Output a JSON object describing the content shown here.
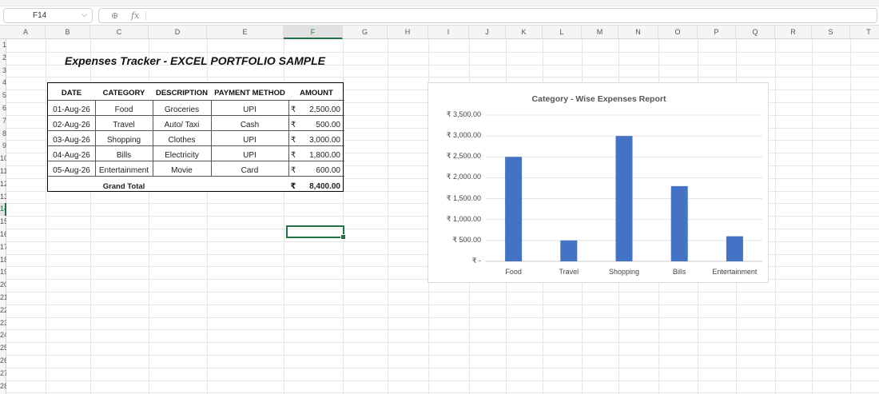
{
  "formula_bar": {
    "cell_reference": "F14",
    "chevron": "⌵",
    "zoom_icon": "⊕",
    "fx_label": "fx",
    "formula": ""
  },
  "columns": [
    "A",
    "B",
    "C",
    "D",
    "E",
    "F",
    "G",
    "H",
    "I",
    "J",
    "K",
    "L",
    "M",
    "N",
    "O",
    "P",
    "Q",
    "R",
    "S",
    "T"
  ],
  "rows": [
    "1",
    "2",
    "3",
    "4",
    "5",
    "6",
    "7",
    "8",
    "9",
    "10",
    "11",
    "12",
    "13",
    "14",
    "15",
    "16",
    "17",
    "18",
    "19",
    "20",
    "21",
    "22",
    "23",
    "24",
    "25",
    "26",
    "27",
    "28"
  ],
  "selected": {
    "column": "F",
    "row": "14"
  },
  "sheet": {
    "title": "Expenses Tracker - EXCEL PORTFOLIO SAMPLE",
    "table": {
      "headers": [
        "DATE",
        "CATEGORY",
        "DESCRIPTION",
        "PAYMENT METHOD",
        "AMOUNT"
      ],
      "rows": [
        {
          "date": "01-Aug-26",
          "category": "Food",
          "description": "Groceries",
          "payment": "UPI",
          "currency": "₹",
          "amount": "2,500.00"
        },
        {
          "date": "02-Aug-26",
          "category": "Travel",
          "description": "Auto/ Taxi",
          "payment": "Cash",
          "currency": "₹",
          "amount": "500.00"
        },
        {
          "date": "03-Aug-26",
          "category": "Shopping",
          "description": "Clothes",
          "payment": "UPI",
          "currency": "₹",
          "amount": "3,000.00"
        },
        {
          "date": "04-Aug-26",
          "category": "Bills",
          "description": "Electricity",
          "payment": "UPI",
          "currency": "₹",
          "amount": "1,800.00"
        },
        {
          "date": "05-Aug-26",
          "category": "Entertainment",
          "description": "Movie",
          "payment": "Card",
          "currency": "₹",
          "amount": "600.00"
        }
      ],
      "total": {
        "label": "Grand Total",
        "currency": "₹",
        "amount": "8,400.00"
      }
    }
  },
  "colors": {
    "bar": "#4472c4",
    "selection": "#217346"
  },
  "chart_data": {
    "type": "bar",
    "title": "Category - Wise Expenses Report",
    "categories": [
      "Food",
      "Travel",
      "Shopping",
      "Bills",
      "Entertainment"
    ],
    "values": [
      2500,
      500,
      3000,
      1800,
      600
    ],
    "ylim": [
      0,
      3500
    ],
    "ytick_values": [
      0,
      500,
      1000,
      1500,
      2000,
      2500,
      3000,
      3500
    ],
    "ytick_labels": [
      "₹ -",
      "₹ 500.00",
      "₹ 1,000.00",
      "₹ 1,500.00",
      "₹ 2,000.00",
      "₹ 2,500.00",
      "₹ 3,000.00",
      "₹ 3,500.00"
    ],
    "grid": true,
    "legend": "none"
  }
}
